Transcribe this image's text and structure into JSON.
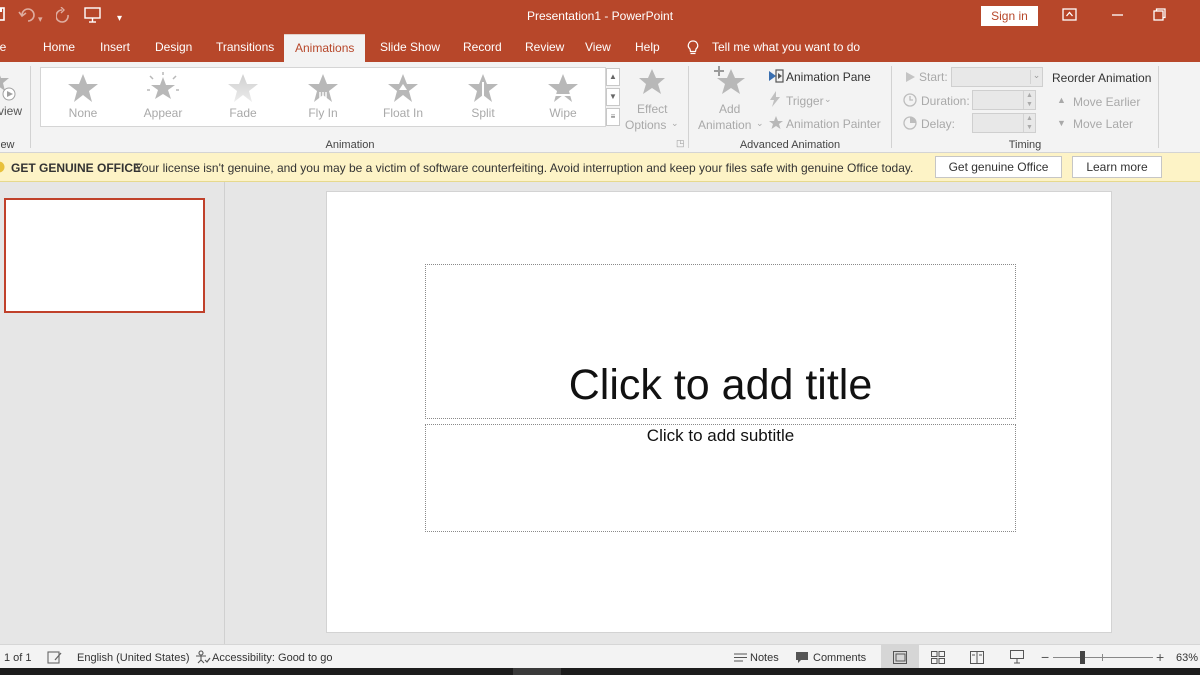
{
  "window": {
    "title": "Presentation1  -  PowerPoint",
    "sign_in": "Sign in"
  },
  "tabs": [
    {
      "label": "le"
    },
    {
      "label": "Home"
    },
    {
      "label": "Insert"
    },
    {
      "label": "Design"
    },
    {
      "label": "Transitions"
    },
    {
      "label": "Animations",
      "active": true
    },
    {
      "label": "Slide Show"
    },
    {
      "label": "Record"
    },
    {
      "label": "Review"
    },
    {
      "label": "View"
    },
    {
      "label": "Help"
    }
  ],
  "tell_me": "Tell me what you want to do",
  "ribbon": {
    "preview": {
      "label": "view",
      "group": "iew"
    },
    "animation_gallery": {
      "items": [
        {
          "label": "None"
        },
        {
          "label": "Appear"
        },
        {
          "label": "Fade"
        },
        {
          "label": "Fly In"
        },
        {
          "label": "Float In"
        },
        {
          "label": "Split"
        },
        {
          "label": "Wipe"
        }
      ],
      "effect_options_line1": "Effect",
      "effect_options_line2": "Options",
      "group": "Animation"
    },
    "advanced": {
      "add_animation_line1": "Add",
      "add_animation_line2": "Animation",
      "animation_pane": "Animation Pane",
      "trigger": "Trigger",
      "animation_painter": "Animation Painter",
      "group": "Advanced Animation"
    },
    "timing": {
      "start": "Start:",
      "duration": "Duration:",
      "delay": "Delay:",
      "reorder": "Reorder Animation",
      "move_earlier": "Move Earlier",
      "move_later": "Move Later",
      "group": "Timing"
    }
  },
  "notification": {
    "heading": "GET GENUINE OFFICE",
    "message": "Your license isn't genuine, and you may be a victim of software counterfeiting. Avoid interruption and keep your files safe with genuine Office today.",
    "get_genuine": "Get genuine Office",
    "learn_more": "Learn more"
  },
  "slide": {
    "title_placeholder": "Click to add title",
    "subtitle_placeholder": "Click to add subtitle"
  },
  "status": {
    "slide_count": "1 of 1",
    "language": "English (United States)",
    "accessibility": "Accessibility: Good to go",
    "notes": "Notes",
    "comments": "Comments",
    "zoom": "63%",
    "zoom_fraction": 0.63
  },
  "colors": {
    "brand": "#b7472a",
    "ribbon_bg": "#f3f3f3",
    "notification_bg": "#fdf3c6"
  }
}
